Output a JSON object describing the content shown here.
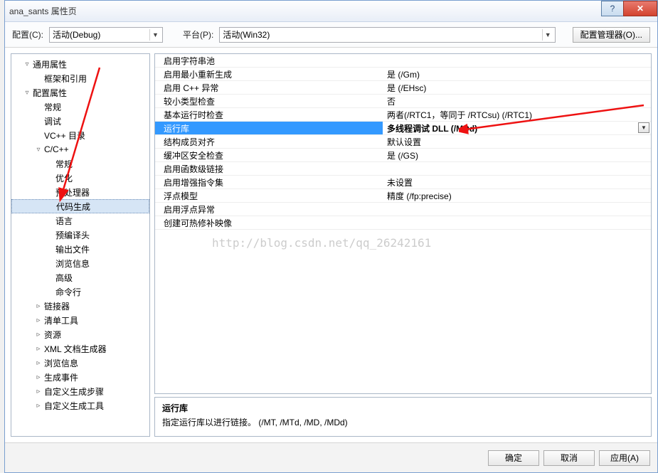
{
  "window": {
    "title": "ana_sants 属性页"
  },
  "toolbar": {
    "config_label": "配置(C):",
    "config_value": "活动(Debug)",
    "platform_label": "平台(P):",
    "platform_value": "活动(Win32)",
    "manager_button": "配置管理器(O)..."
  },
  "tree": {
    "items": [
      {
        "indent": 1,
        "exp": "▿",
        "label": "通用属性"
      },
      {
        "indent": 2,
        "exp": "",
        "label": "框架和引用"
      },
      {
        "indent": 1,
        "exp": "▿",
        "label": "配置属性"
      },
      {
        "indent": 2,
        "exp": "",
        "label": "常规"
      },
      {
        "indent": 2,
        "exp": "",
        "label": "调试"
      },
      {
        "indent": 2,
        "exp": "",
        "label": "VC++ 目录"
      },
      {
        "indent": 2,
        "exp": "▿",
        "label": "C/C++"
      },
      {
        "indent": 3,
        "exp": "",
        "label": "常规"
      },
      {
        "indent": 3,
        "exp": "",
        "label": "优化"
      },
      {
        "indent": 3,
        "exp": "",
        "label": "预处理器"
      },
      {
        "indent": 3,
        "exp": "",
        "label": "代码生成",
        "selected": true
      },
      {
        "indent": 3,
        "exp": "",
        "label": "语言"
      },
      {
        "indent": 3,
        "exp": "",
        "label": "预编译头"
      },
      {
        "indent": 3,
        "exp": "",
        "label": "输出文件"
      },
      {
        "indent": 3,
        "exp": "",
        "label": "浏览信息"
      },
      {
        "indent": 3,
        "exp": "",
        "label": "高级"
      },
      {
        "indent": 3,
        "exp": "",
        "label": "命令行"
      },
      {
        "indent": 2,
        "exp": "▹",
        "label": "链接器"
      },
      {
        "indent": 2,
        "exp": "▹",
        "label": "清单工具"
      },
      {
        "indent": 2,
        "exp": "▹",
        "label": "资源"
      },
      {
        "indent": 2,
        "exp": "▹",
        "label": "XML 文档生成器"
      },
      {
        "indent": 2,
        "exp": "▹",
        "label": "浏览信息"
      },
      {
        "indent": 2,
        "exp": "▹",
        "label": "生成事件"
      },
      {
        "indent": 2,
        "exp": "▹",
        "label": "自定义生成步骤"
      },
      {
        "indent": 2,
        "exp": "▹",
        "label": "自定义生成工具"
      }
    ]
  },
  "props": {
    "rows": [
      {
        "name": "启用字符串池",
        "value": ""
      },
      {
        "name": "启用最小重新生成",
        "value": "是 (/Gm)"
      },
      {
        "name": "启用 C++ 异常",
        "value": "是 (/EHsc)"
      },
      {
        "name": "较小类型检查",
        "value": "否"
      },
      {
        "name": "基本运行时检查",
        "value": "两者(/RTC1，等同于 /RTCsu) (/RTC1)"
      },
      {
        "name": "运行库",
        "value": "多线程调试 DLL (/MDd)",
        "selected": true
      },
      {
        "name": "结构成员对齐",
        "value": "默认设置"
      },
      {
        "name": "缓冲区安全检查",
        "value": "是 (/GS)"
      },
      {
        "name": "启用函数级链接",
        "value": ""
      },
      {
        "name": "启用增强指令集",
        "value": "未设置"
      },
      {
        "name": "浮点模型",
        "value": "精度 (/fp:precise)"
      },
      {
        "name": "启用浮点异常",
        "value": ""
      },
      {
        "name": "创建可热修补映像",
        "value": ""
      }
    ]
  },
  "desc": {
    "title": "运行库",
    "text": "指定运行库以进行链接。      (/MT, /MTd, /MD, /MDd)"
  },
  "footer": {
    "ok": "确定",
    "cancel": "取消",
    "apply": "应用(A)"
  },
  "watermark": "http://blog.csdn.net/qq_26242161"
}
